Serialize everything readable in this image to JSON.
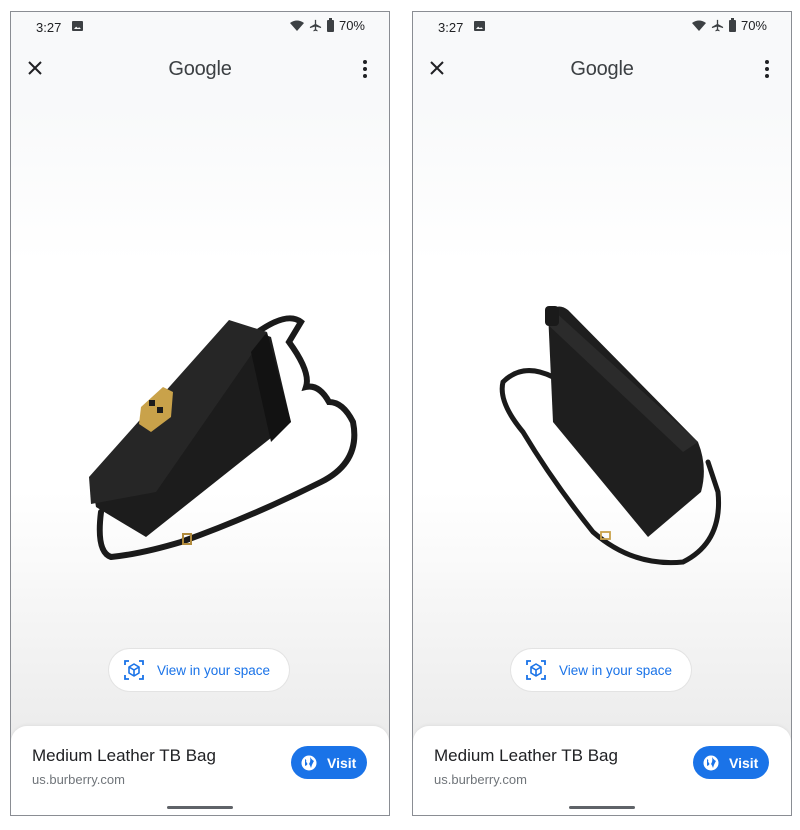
{
  "screens": [
    {
      "status_bar": {
        "time": "3:27",
        "battery": "70%",
        "icons": [
          "image-icon",
          "wifi-icon",
          "airplane-icon",
          "battery-icon"
        ]
      },
      "top_bar": {
        "title": "Google",
        "close_icon": "close-icon",
        "menu_icon": "more-vert-icon"
      },
      "viewer": {
        "object": "3D model of black leather bag with gold TB clasp (front view)"
      },
      "ar_button": {
        "label": "View in your space",
        "icon": "ar-cube-icon"
      },
      "product": {
        "name": "Medium Leather TB Bag",
        "source": "us.burberry.com",
        "visit_label": "Visit",
        "visit_icon": "globe-icon"
      }
    },
    {
      "status_bar": {
        "time": "3:27",
        "battery": "70%",
        "icons": [
          "image-icon",
          "wifi-icon",
          "airplane-icon",
          "battery-icon"
        ]
      },
      "top_bar": {
        "title": "Google",
        "close_icon": "close-icon",
        "menu_icon": "more-vert-icon"
      },
      "viewer": {
        "object": "3D model of black leather bag rotated (back view)"
      },
      "ar_button": {
        "label": "View in your space",
        "icon": "ar-cube-icon"
      },
      "product": {
        "name": "Medium Leather TB Bag",
        "source": "us.burberry.com",
        "visit_label": "Visit",
        "visit_icon": "globe-icon"
      }
    }
  ],
  "colors": {
    "accent": "#1a73e8",
    "text": "#202124",
    "secondary_text": "#70757a",
    "bag": "#1c1c1c",
    "clasp": "#c9a24a"
  }
}
